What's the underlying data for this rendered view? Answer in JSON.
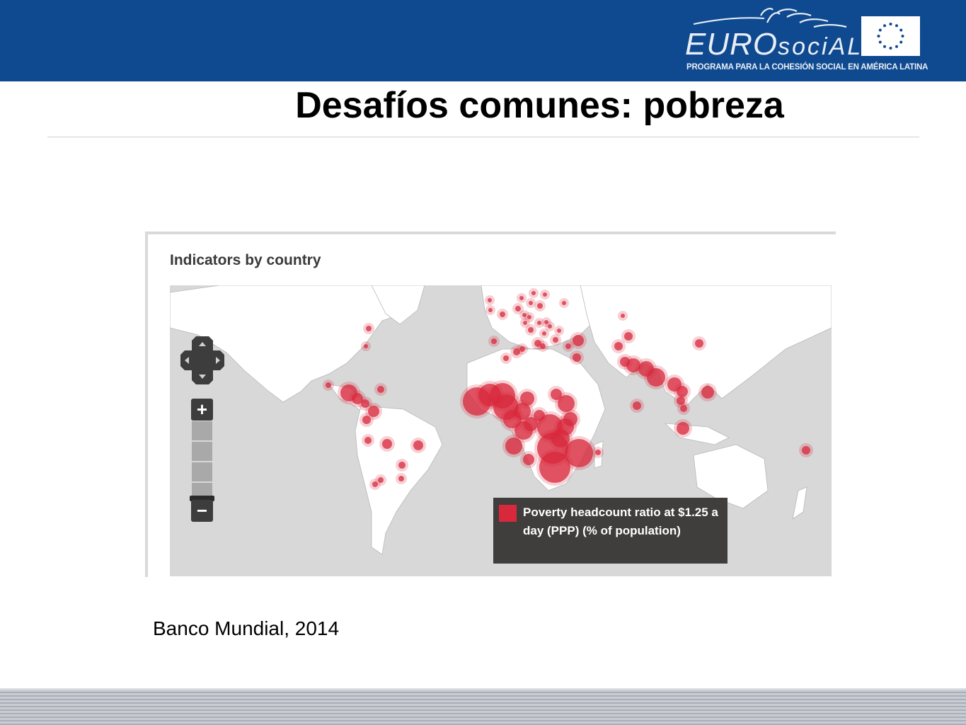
{
  "header": {
    "logo": {
      "wordmark_caps": "EURO",
      "wordmark_small": "sociAL",
      "tagline": "PROGRAMA PARA LA COHESIÓN SOCIAL EN AMÉRICA LATINA"
    },
    "colors": {
      "band": "#0f4a90",
      "logo_text": "#e9eef6"
    }
  },
  "slide": {
    "title": "Desafíos comunes: pobreza",
    "source": "Banco Mundial, 2014"
  },
  "widget": {
    "title": "Indicators by country",
    "map": {
      "type": "bubble map",
      "projection": "world",
      "bubble_color": "#d8283c",
      "land_color": "#ffffff",
      "ocean_color": "#d8d8d8",
      "highlighted_regions": [
        "Sub-Saharan Africa",
        "South Asia",
        "Latin America",
        "Southeast Asia"
      ]
    },
    "controls": {
      "pan_icon": "pan-cross-icon",
      "zoom_in_label": "+",
      "zoom_out_label": "−",
      "zoom_level": 0.05
    },
    "legend": {
      "color": "#d8283c",
      "text": "Poverty headcount ratio at $1.25 a day (PPP) (% of population)"
    }
  }
}
